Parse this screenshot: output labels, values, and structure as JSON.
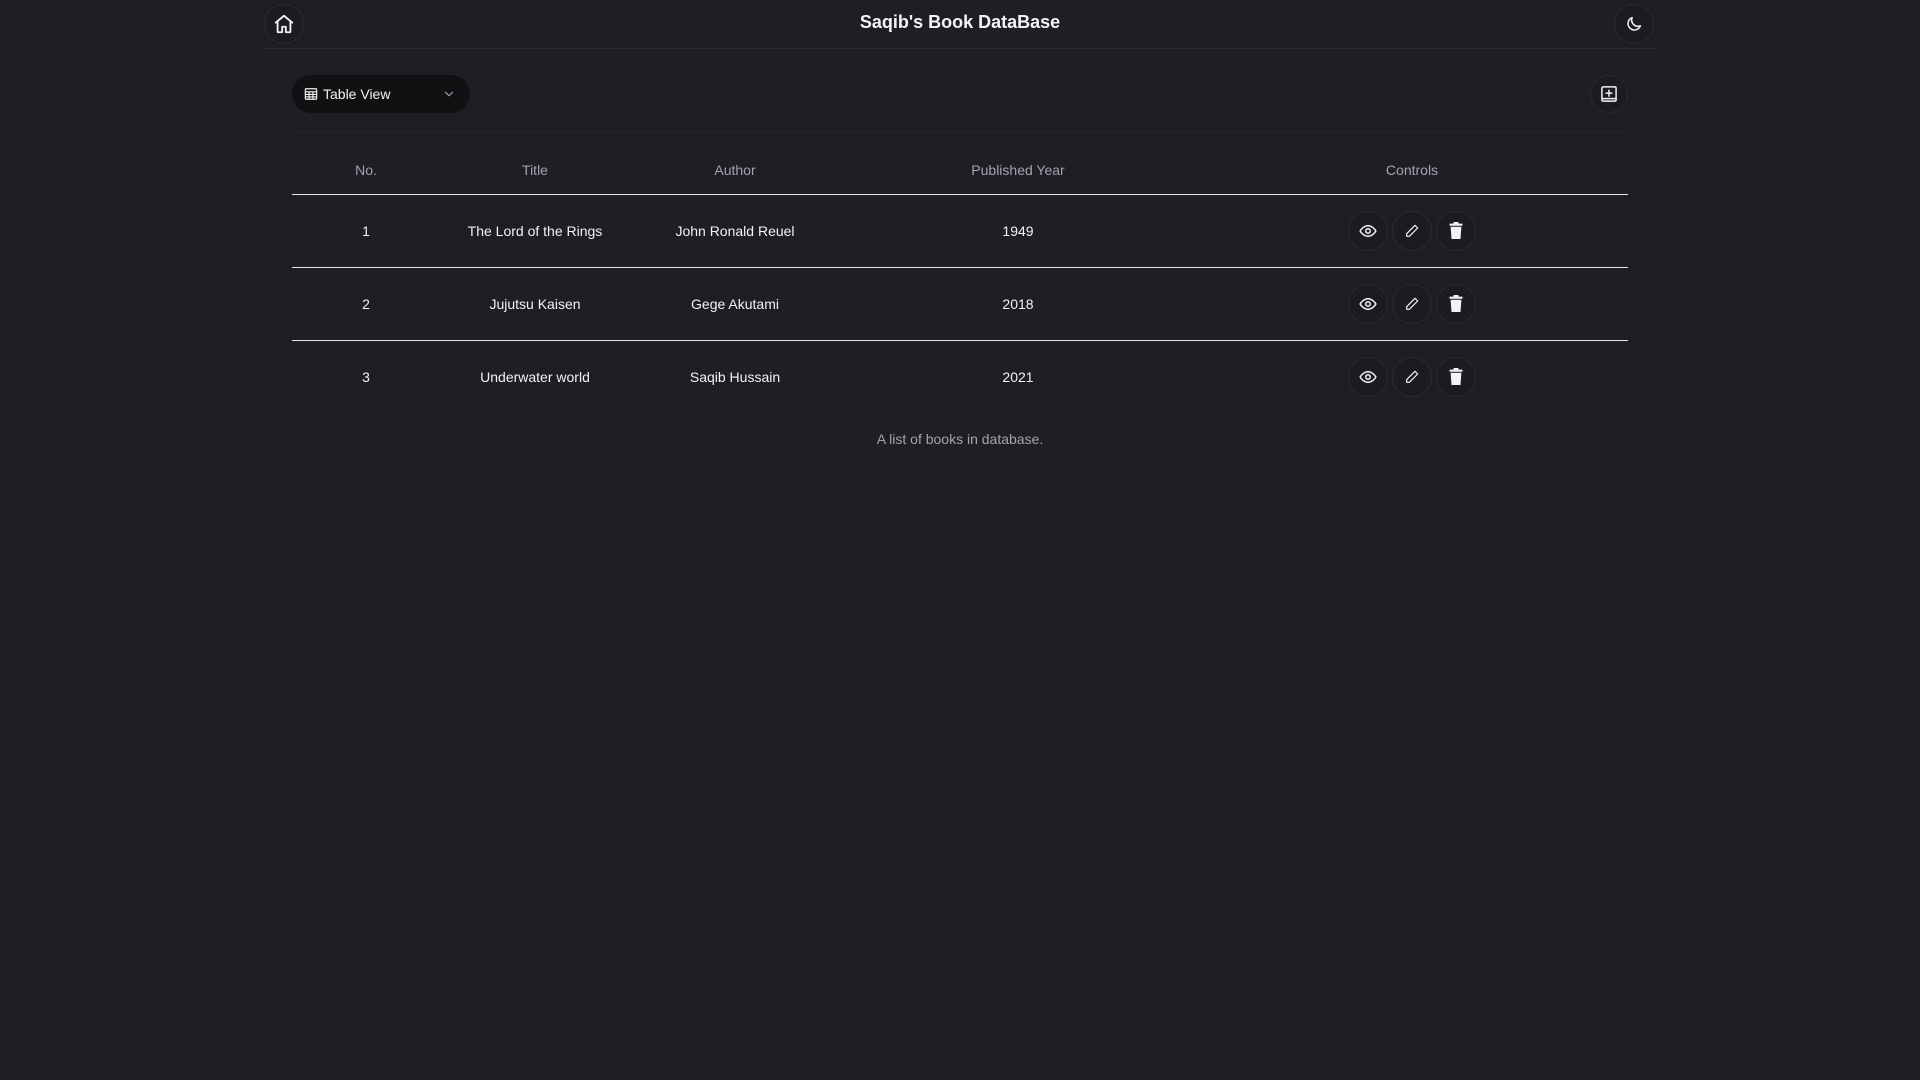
{
  "header": {
    "title": "Saqib's Book DataBase",
    "home_icon": "home-icon",
    "theme_icon": "moon-icon"
  },
  "toolbar": {
    "view_select": {
      "selected": "Table View",
      "icon": "table-icon"
    },
    "add_icon": "add-book-icon"
  },
  "table": {
    "columns": [
      "No.",
      "Title",
      "Author",
      "Published Year",
      "Controls"
    ],
    "rows": [
      {
        "no": "1",
        "title": "The Lord of the Rings",
        "author": "John Ronald Reuel",
        "year": "1949"
      },
      {
        "no": "2",
        "title": "Jujutsu Kaisen",
        "author": "Gege Akutami",
        "year": "2018"
      },
      {
        "no": "3",
        "title": "Underwater world",
        "author": "Saqib Hussain",
        "year": "2021"
      }
    ],
    "caption": "A list of books in database.",
    "control_icons": [
      "eye-icon",
      "pencil-icon",
      "trash-icon"
    ]
  },
  "colors": {
    "background": "#1e1e24",
    "text": "#f2f2f5",
    "muted": "#a3a3b0",
    "divider": "#e6e6ea"
  }
}
